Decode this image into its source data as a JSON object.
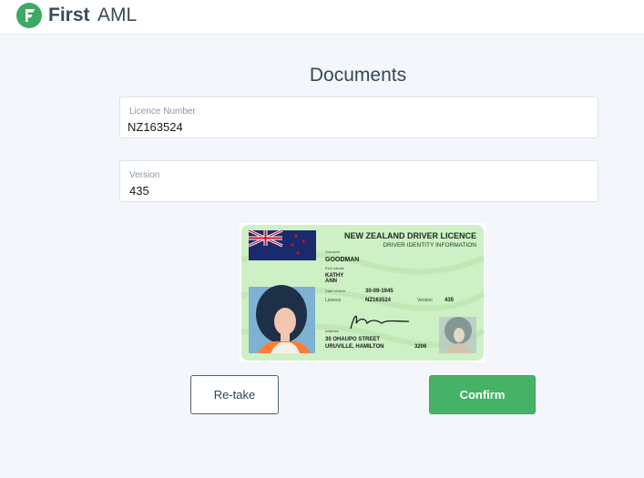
{
  "header": {
    "brand_first": "First",
    "brand_second": "AML",
    "logo_icon": "first-aml-logo-icon"
  },
  "page": {
    "title": "Documents"
  },
  "form": {
    "licence_number": {
      "label": "Licence Number",
      "value": "NZ163524"
    },
    "version": {
      "label": "Version",
      "value": "435"
    }
  },
  "id_card": {
    "title": "NEW ZEALAND DRIVER LICENCE",
    "subtitle": "DRIVER IDENTITY INFORMATION",
    "surname_label": "Surname",
    "surname": "GOODMAN",
    "first_names_label": "First names",
    "first_names_line1": "KATHY",
    "first_names_line2": "ANN",
    "dob_label": "Date of birth",
    "dob": "30-09-1945",
    "licence_label": "Licence",
    "licence": "NZ163524",
    "version_label": "Version",
    "version": "435",
    "address_label": "Address",
    "address_line1": "30 OHAUPO STREET",
    "address_line2": "URUVILLE, HAMILTON",
    "postcode": "3206",
    "colors": {
      "card_bg": "#cdf0c4",
      "flag_blue": "#1a2a6c",
      "flag_red": "#c8102e"
    }
  },
  "actions": {
    "retake_label": "Re-take",
    "confirm_label": "Confirm"
  },
  "colors": {
    "brand_green": "#45b265",
    "background": "#f3f6fa"
  }
}
